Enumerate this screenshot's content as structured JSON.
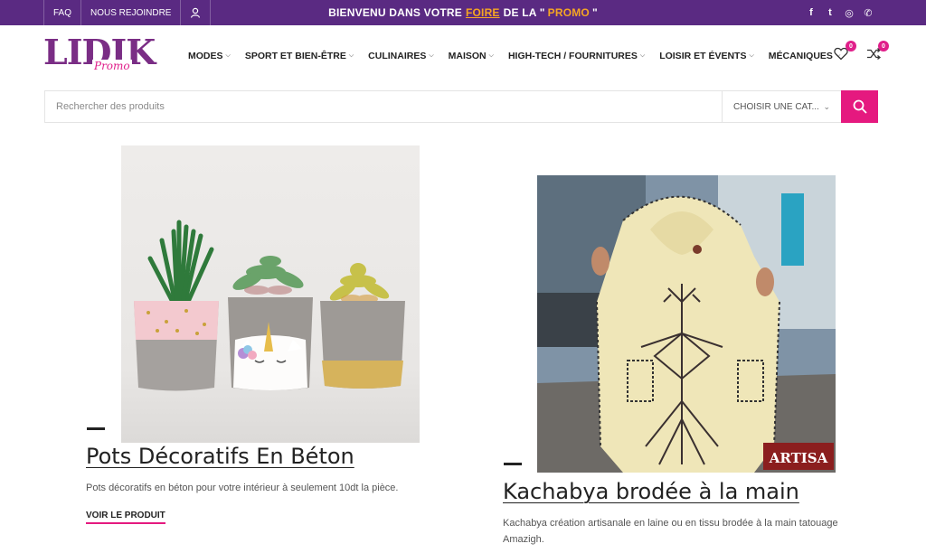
{
  "topbar": {
    "links": [
      "FAQ",
      "NOUS REJOINDRE"
    ],
    "message_before": "BIENVENU DANS VOTRE",
    "message_highlight": "FOIRE",
    "message_mid": "DE LA \"",
    "message_promo": "PROMO",
    "message_end": "\"",
    "social": [
      "f",
      "t",
      "◎",
      "✆"
    ]
  },
  "logo": {
    "text": "LIDIK",
    "sub": "Promo"
  },
  "nav": [
    "MODES",
    "SPORT ET BIEN-ÊTRE",
    "CULINAIRES",
    "MAISON",
    "HIGH-TECH / FOURNITURES",
    "LOISIR ET ÉVENTS",
    "MÉCANIQUES"
  ],
  "header_icons": {
    "wishlist_count": "0",
    "compare_count": "0"
  },
  "search": {
    "placeholder": "Rechercher des produits",
    "category": "CHOISIR UNE CAT..."
  },
  "products": [
    {
      "title": "Pots Décoratifs En Béton",
      "description": "Pots décoratifs en béton pour votre intérieur à seulement 10dt la pièce.",
      "link": "VOIR LE PRODUIT"
    },
    {
      "title": "Kachabya brodée à la main",
      "description_line1": "Kachabya création artisanale en laine ou en tissu brodée à la main tatouage",
      "description_line2": "Amazigh."
    }
  ],
  "watermark": "ARTISA",
  "colors": {
    "topbar": "#5a2a82",
    "accent": "#e5197f",
    "highlight": "#f5a623",
    "logo": "#7a2d85"
  }
}
